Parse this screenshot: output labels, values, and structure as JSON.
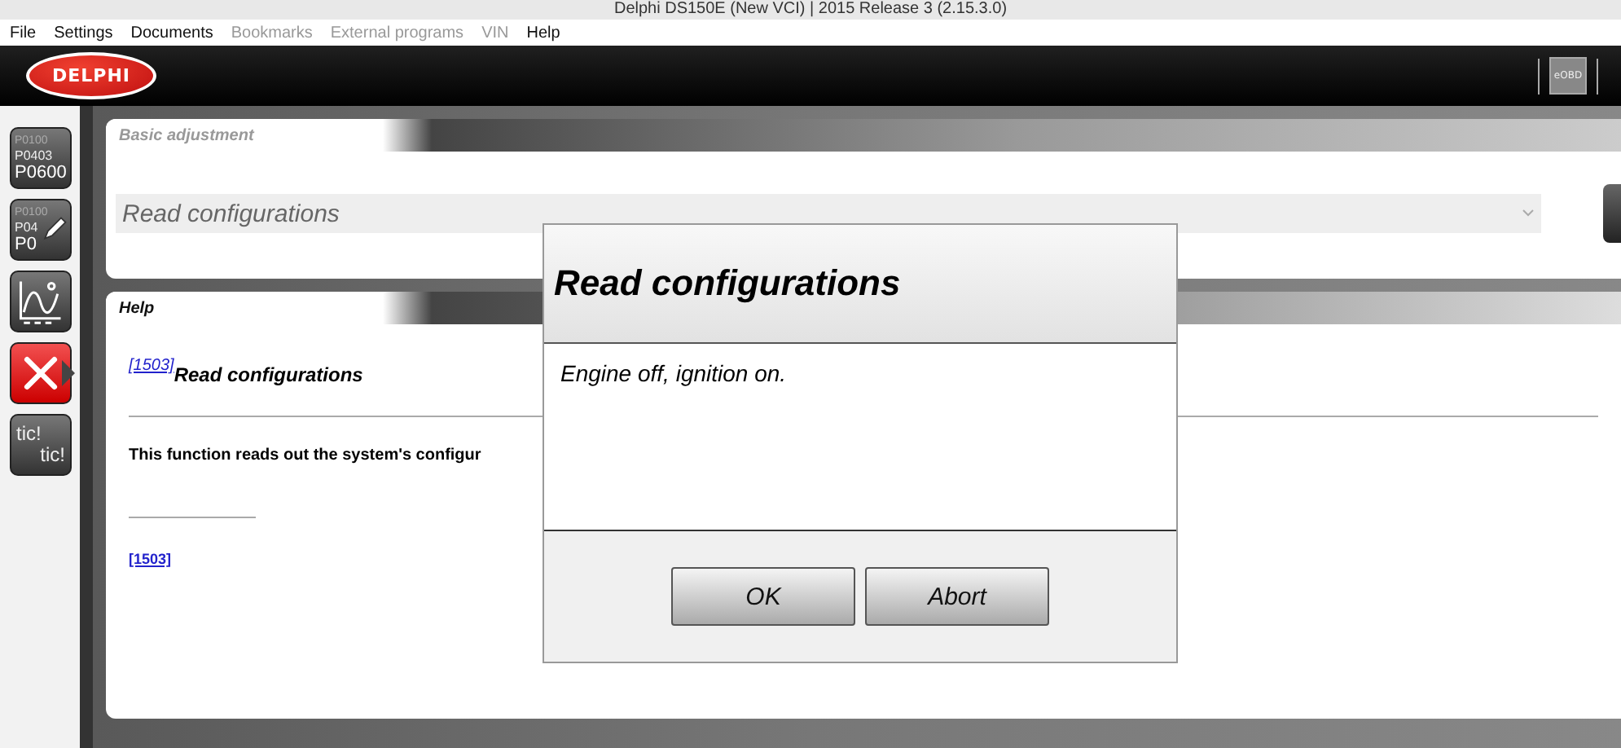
{
  "window": {
    "title": "Delphi DS150E (New VCI) | 2015 Release 3 (2.15.3.0)"
  },
  "menu": [
    {
      "label": "File",
      "disabled": false
    },
    {
      "label": "Settings",
      "disabled": false
    },
    {
      "label": "Documents",
      "disabled": false
    },
    {
      "label": "Bookmarks",
      "disabled": true
    },
    {
      "label": "External programs",
      "disabled": true
    },
    {
      "label": "VIN",
      "disabled": true
    },
    {
      "label": "Help",
      "disabled": false
    }
  ],
  "header": {
    "logo": "DELPHI",
    "eobd_button": "eOBD"
  },
  "sidebar": {
    "items": [
      {
        "kind": "codes",
        "lines": [
          "P0100",
          "P0403",
          "P0600"
        ],
        "selected": false
      },
      {
        "kind": "codes-edit",
        "lines": [
          "P0100",
          "P04",
          "P0"
        ],
        "selected": false
      },
      {
        "kind": "graph",
        "selected": false
      },
      {
        "kind": "tools",
        "selected": true
      },
      {
        "kind": "tic",
        "lines": [
          "tic!",
          "tic!"
        ],
        "selected": false
      }
    ]
  },
  "adjustment_panel": {
    "title": "Basic adjustment",
    "function_select": {
      "value": "Read configurations"
    }
  },
  "help_panel": {
    "title": "Help",
    "ref_link": "[1503]",
    "heading": "Read configurations",
    "text": "This function reads out the system's configur",
    "footnote_link": "[1503]"
  },
  "dialog": {
    "title": "Read configurations",
    "message": "Engine off, ignition on.",
    "buttons": [
      "OK",
      "Abort"
    ]
  }
}
